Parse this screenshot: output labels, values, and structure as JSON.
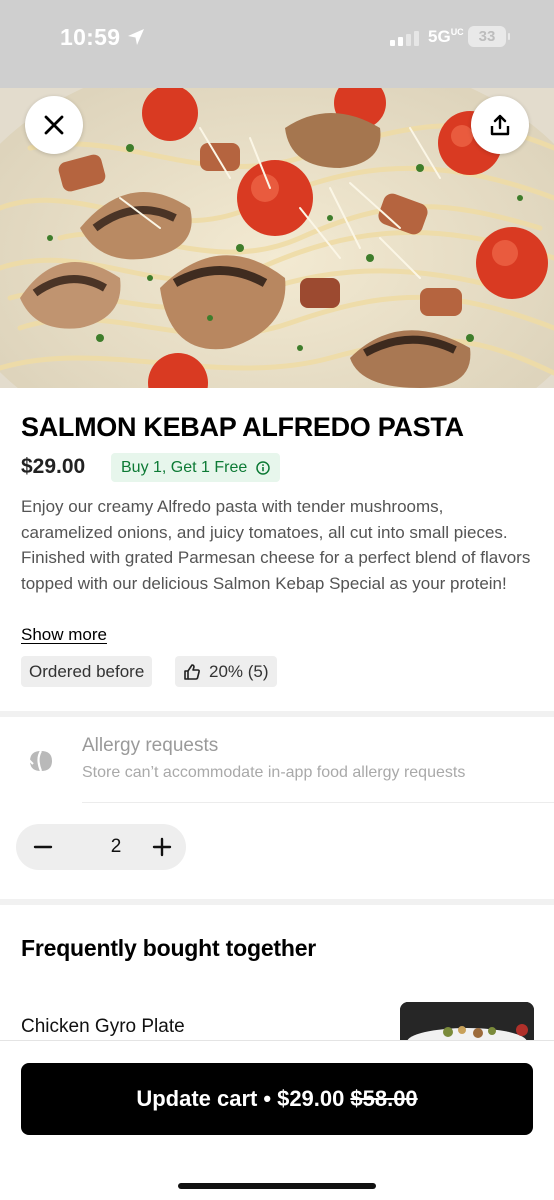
{
  "status_bar": {
    "time": "10:59",
    "network": "5G",
    "network_suffix": "UC",
    "battery": "33",
    "location_icon": "location-arrow-icon",
    "signal_icon": "cell-signal-icon"
  },
  "header": {
    "close_icon": "close-icon",
    "share_icon": "share-icon"
  },
  "item": {
    "title": "SALMON KEBAP ALFREDO PASTA",
    "price": "$29.00",
    "promo": "Buy 1, Get 1 Free",
    "promo_icon": "info-icon",
    "description": "Enjoy our creamy Alfredo pasta with tender mushrooms, caramelized onions, and juicy tomatoes, all cut into small pieces. Finished with grated Parmesan cheese for a perfect blend of flavors topped with our delicious Salmon Kebap Special as your protein!",
    "show_more": "Show more",
    "badges": {
      "ordered_before": "Ordered before",
      "rating": "20% (5)",
      "rating_icon": "thumbs-up-icon"
    }
  },
  "allergy": {
    "icon": "leaf-icon",
    "title": "Allergy requests",
    "subtitle": "Store can’t accommodate in-app food allergy requests"
  },
  "quantity": {
    "value": "2",
    "minus_icon": "minus-icon",
    "plus_icon": "plus-icon"
  },
  "frequently_bought": {
    "title": "Frequently bought together",
    "items": [
      {
        "name": "Chicken Gyro Plate"
      }
    ]
  },
  "cart": {
    "label": "Update cart",
    "separator": "•",
    "price": "$29.00",
    "original_price": "$58.00"
  },
  "colors": {
    "promo_bg": "#e7f6ec",
    "promo_text": "#0d7a35",
    "button_bg": "#000000",
    "status_bar_bg": "#cfcfcf"
  }
}
